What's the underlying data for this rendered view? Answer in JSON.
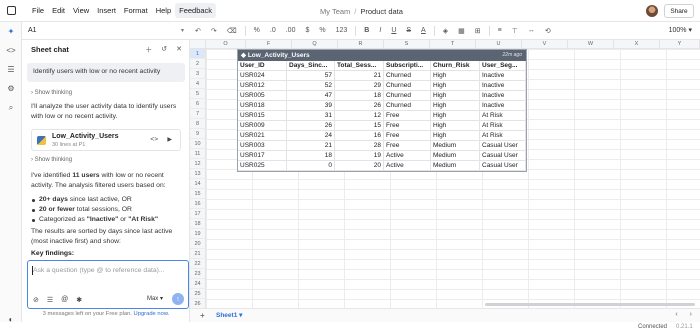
{
  "menu": {
    "items": [
      "File",
      "Edit",
      "View",
      "Insert",
      "Format",
      "Help",
      "Feedback"
    ],
    "team": "My Team",
    "doc": "Product data",
    "share": "Share"
  },
  "namebox": {
    "ref": "A1"
  },
  "toolbar": {
    "items": [
      "%",
      ".0",
      ".00",
      "$",
      "%",
      "123",
      "B",
      "I",
      "U",
      "S",
      "A",
      "⌫",
      "≡",
      "⊤",
      "↔",
      "≡"
    ],
    "zoom": "100%"
  },
  "chat": {
    "title": "Sheet chat",
    "user_msg": "Identify users with low or no recent activity",
    "show_thinking": "Show thinking",
    "reply1": "I'll analyze the user activity data to identify users with low or no recent activity.",
    "code_title": "Low_Activity_Users",
    "code_sub": "30 lines at P1",
    "reply2_pre": "I've identified ",
    "reply2_bold": "11 users",
    "reply2_post": " with low or no recent activity. The analysis filtered users based on:",
    "bullets": [
      {
        "bold": "20+ days",
        "text": " since last active, OR"
      },
      {
        "bold": "20 or fewer",
        "text": " total sessions, OR"
      },
      {
        "pre": "Categorized as ",
        "bold": "\"Inactive\"",
        "mid": " or ",
        "bold2": "\"At Risk\""
      }
    ],
    "reply3": "The results are sorted by days since last active (most inactive first) and show:",
    "key_findings": "Key findings:",
    "input_placeholder": "Ask a question (type @ to reference data)...",
    "model": "Max",
    "messages_left": "3 messages left on your Free plan.",
    "upgrade": "Upgrade now."
  },
  "grid": {
    "columns": [
      "O",
      "F",
      "Q",
      "R",
      "S",
      "T",
      "U",
      "V",
      "W",
      "X",
      "Y"
    ],
    "rows": [
      "1",
      "2",
      "3",
      "4",
      "5",
      "6",
      "7",
      "8",
      "9",
      "10",
      "11",
      "12",
      "13",
      "14",
      "15",
      "16",
      "17",
      "18",
      "19",
      "20",
      "21",
      "22",
      "23",
      "24",
      "25",
      "26"
    ]
  },
  "table": {
    "title": "Low_Activity_Users",
    "updated": "22m ago",
    "headers": [
      "User_ID",
      "Days_Sinc...",
      "Total_Sess...",
      "Subscripti...",
      "Churn_Risk",
      "User_Seg..."
    ],
    "rows": [
      [
        "USR024",
        "57",
        "21",
        "Churned",
        "High",
        "Inactive"
      ],
      [
        "USR012",
        "52",
        "29",
        "Churned",
        "High",
        "Inactive"
      ],
      [
        "USR005",
        "47",
        "18",
        "Churned",
        "High",
        "Inactive"
      ],
      [
        "USR018",
        "39",
        "26",
        "Churned",
        "High",
        "Inactive"
      ],
      [
        "USR015",
        "31",
        "12",
        "Free",
        "High",
        "At Risk"
      ],
      [
        "USR009",
        "26",
        "15",
        "Free",
        "High",
        "At Risk"
      ],
      [
        "USR021",
        "24",
        "16",
        "Free",
        "High",
        "At Risk"
      ],
      [
        "USR003",
        "21",
        "28",
        "Free",
        "Medium",
        "Casual User"
      ],
      [
        "USR017",
        "18",
        "19",
        "Active",
        "Medium",
        "Casual User"
      ],
      [
        "USR025",
        "0",
        "20",
        "Active",
        "Medium",
        "Casual User"
      ]
    ]
  },
  "bottom": {
    "sheet": "Sheet1",
    "status": "Connected",
    "version": "0.21.1"
  }
}
